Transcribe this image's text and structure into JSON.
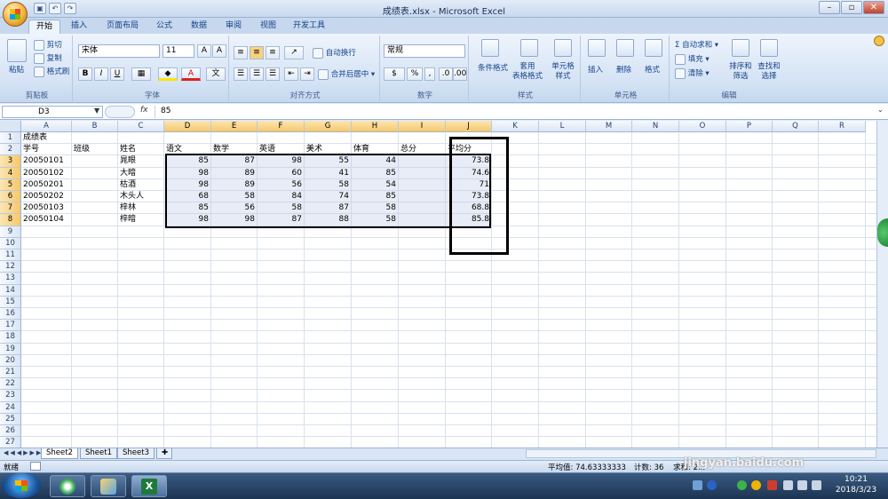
{
  "window": {
    "title": "成绩表.xlsx - Microsoft Excel"
  },
  "ribbon_tabs": [
    "开始",
    "插入",
    "页面布局",
    "公式",
    "数据",
    "审阅",
    "视图",
    "开发工具"
  ],
  "clipboard": {
    "paste": "粘贴",
    "cut": "剪切",
    "copy": "复制",
    "format_painter": "格式刷",
    "group": "剪贴板"
  },
  "font": {
    "name": "宋体",
    "size": "11",
    "group": "字体",
    "bold": "B",
    "italic": "I",
    "underline": "U"
  },
  "alignment": {
    "wrap": "自动换行",
    "merge": "合并后居中",
    "group": "对齐方式"
  },
  "number": {
    "format": "常规",
    "group": "数字"
  },
  "styles": {
    "conditional": "条件格式",
    "table": "套用\n表格格式",
    "cell_styles": "单元格\n样式",
    "group": "样式"
  },
  "cells": {
    "insert": "插入",
    "delete": "删除",
    "format": "格式",
    "group": "单元格"
  },
  "editing": {
    "autosum": "自动求和",
    "fill": "填充",
    "clear": "清除",
    "sort": "排序和\n筛选",
    "find": "查找和\n选择",
    "group": "编辑"
  },
  "formula_bar": {
    "name_box": "D3",
    "fx": "fx",
    "value": "85"
  },
  "columns": [
    "A",
    "B",
    "C",
    "D",
    "E",
    "F",
    "G",
    "H",
    "I",
    "J",
    "K",
    "L",
    "M",
    "N",
    "O",
    "P",
    "Q",
    "R"
  ],
  "rows": [
    "1",
    "2",
    "3",
    "4",
    "5",
    "6",
    "7",
    "8",
    "9",
    "10",
    "11",
    "12",
    "13",
    "14",
    "15",
    "16",
    "17",
    "18",
    "19",
    "20",
    "21",
    "22",
    "23",
    "24",
    "25",
    "26",
    "27"
  ],
  "sheet": {
    "title": "成绩表",
    "headers": [
      "学号",
      "班级",
      "姓名",
      "语文",
      "数学",
      "英语",
      "美术",
      "体育",
      "总分",
      "平均分"
    ],
    "records": [
      {
        "id": "20050101",
        "name": "晁眼",
        "scores": [
          "85",
          "87",
          "98",
          "55",
          "44"
        ],
        "avg": "73.8"
      },
      {
        "id": "20050102",
        "name": "大暗",
        "scores": [
          "98",
          "89",
          "60",
          "41",
          "85"
        ],
        "avg": "74.6"
      },
      {
        "id": "20050201",
        "name": "枯酒",
        "scores": [
          "98",
          "89",
          "56",
          "58",
          "54"
        ],
        "avg": "71"
      },
      {
        "id": "20050202",
        "name": "木头人",
        "scores": [
          "68",
          "58",
          "84",
          "74",
          "85"
        ],
        "avg": "73.8"
      },
      {
        "id": "20050103",
        "name": "梓林",
        "scores": [
          "85",
          "56",
          "58",
          "87",
          "58"
        ],
        "avg": "68.8"
      },
      {
        "id": "20050104",
        "name": "梓暗",
        "scores": [
          "98",
          "98",
          "87",
          "88",
          "58"
        ],
        "avg": "85.8"
      }
    ]
  },
  "sheet_tabs": [
    "Sheet2",
    "Sheet1",
    "Sheet3"
  ],
  "status": {
    "ready": "就绪",
    "average": "平均值: 74.63333333",
    "count": "计数: 36",
    "sum_partial": "求和: 2..."
  },
  "watermark": "jingyan.baidu.com",
  "taskbar": {
    "time": "10:21",
    "date": "2018/3/23"
  }
}
